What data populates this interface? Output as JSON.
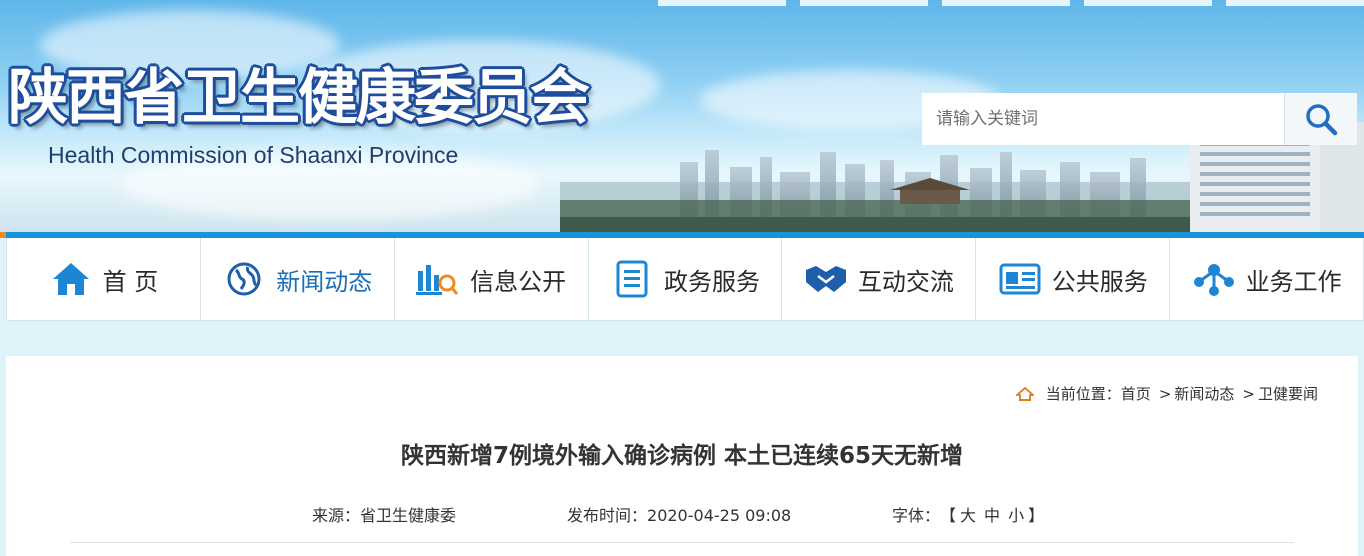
{
  "header": {
    "title_cn": "陕西省卫生健康委员会",
    "title_en": "Health Commission of Shaanxi Province",
    "search_placeholder": "请输入关键词",
    "search_icon": "search-icon"
  },
  "colors": {
    "nav_accent": "#1794d8",
    "nav_accent_orange": "#f08c1e",
    "active_nav_text": "#1b6fb8",
    "logo_outline": "#1d4d9c"
  },
  "nav": [
    {
      "label": "首 页",
      "icon": "home-icon"
    },
    {
      "label": "新闻动态",
      "icon": "globe-icon"
    },
    {
      "label": "信息公开",
      "icon": "chart-search-icon"
    },
    {
      "label": "政务服务",
      "icon": "document-icon"
    },
    {
      "label": "互动交流",
      "icon": "handshake-icon"
    },
    {
      "label": "公共服务",
      "icon": "id-card-icon"
    },
    {
      "label": "业务工作",
      "icon": "network-icon"
    }
  ],
  "breadcrumb": {
    "prefix": "当前位置：",
    "items": [
      "首页",
      "新闻动态",
      "卫健要闻"
    ],
    "separator": ">"
  },
  "article": {
    "title": "陕西新增7例境外输入确诊病例 本土已连续65天无新增",
    "source_label": "来源：",
    "source": "省卫生健康委",
    "date_label": "发布时间：",
    "date": "2020-04-25 09:08",
    "font_label": "字体：",
    "bracket_open": "【",
    "bracket_close": "】",
    "font_sizes": [
      "大",
      "中",
      "小"
    ]
  }
}
